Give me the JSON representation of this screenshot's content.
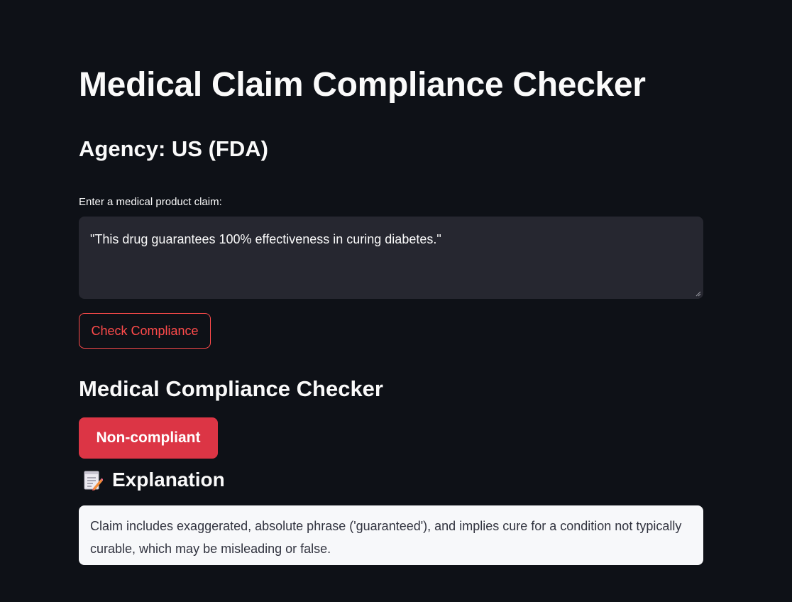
{
  "header": {
    "title": "Medical Claim Compliance Checker",
    "agency": "Agency: US (FDA)"
  },
  "form": {
    "claim_label": "Enter a medical product claim:",
    "claim_value": "\"This drug guarantees 100% effectiveness in curing diabetes.\"",
    "submit_label": "Check Compliance"
  },
  "result": {
    "section_title": "Medical Compliance Checker",
    "status_label": "Non-compliant",
    "explanation_icon": "memo-icon",
    "explanation_title": "Explanation",
    "explanation_text": "Claim includes exaggerated, absolute phrase ('guaranteed'), and implies cure for a condition not typically curable, which may be misleading or false."
  },
  "colors": {
    "background": "#0e1117",
    "input_background": "#262730",
    "accent": "#ff4b4b",
    "status_noncompliant": "#dc3545",
    "explanation_background": "#f7f8fa"
  }
}
